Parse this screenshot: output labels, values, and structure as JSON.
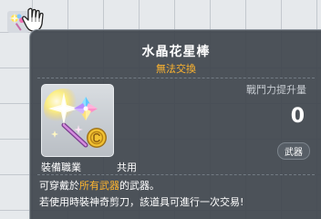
{
  "tooltip": {
    "title": "水晶花星棒",
    "subtitle": "無法交換",
    "stat_label": "戰鬥力提升量",
    "stat_value": "0",
    "type_badge": "武器",
    "job_label": "裝備職業",
    "job_value": "共用",
    "desc_prefix": "可穿戴於",
    "desc_highlight": "所有武器",
    "desc_suffix": "的武器。",
    "desc_line2": "若使用時裝神奇剪刀，該道具可進行一次交易!"
  },
  "colors": {
    "highlight": "#ffb52e",
    "tooltip_bg": "#40464e"
  },
  "icons": {
    "item_icon": "crystal-flower-star-wand-icon",
    "cursor": "hand-cursor-icon",
    "coin": "gold-coin-icon"
  }
}
